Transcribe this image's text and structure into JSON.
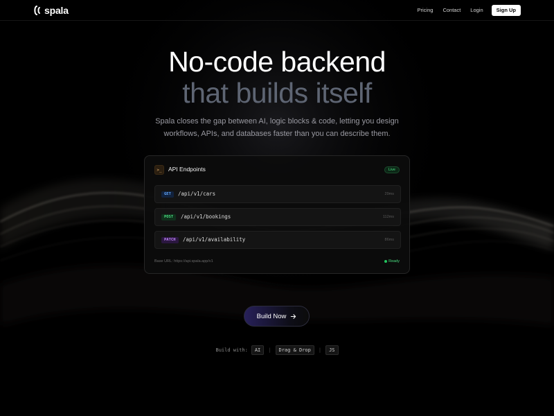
{
  "nav": {
    "brand": "spala",
    "links": [
      "Pricing",
      "Contact",
      "Login"
    ],
    "signup_label": "Sign Up",
    "logo_icon": "spala-logo-icon"
  },
  "hero": {
    "title_line1": "No-code backend",
    "title_line2": "that builds itself",
    "subtitle_line1": "Spala closes the gap between AI, logic blocks & code, letting you design",
    "subtitle_line2": "workflows, APIs, and databases faster than you can describe them."
  },
  "card": {
    "icon_glyph": ">_",
    "title": "API Endpoints",
    "status_badge": "Live",
    "endpoints": [
      {
        "method": "GET",
        "path": "/api/v1/cars",
        "latency": "29ms"
      },
      {
        "method": "POST",
        "path": "/api/v1/bookings",
        "latency": "112ms"
      },
      {
        "method": "PATCH",
        "path": "/api/v1/availability",
        "latency": "86ms"
      }
    ],
    "base_url": "Base URL: https://api.spala.app/v1",
    "ready_label": "Ready"
  },
  "cta": {
    "label": "Build Now",
    "icon": "arrow-right-icon"
  },
  "build_with": {
    "label": "Build with:",
    "options": [
      "AI",
      "Drag & Drop",
      "JS"
    ],
    "separator": "|"
  },
  "colors": {
    "background": "#000000",
    "title_secondary": "#5e6573",
    "live_green": "#4ade80",
    "get_blue": "#60a5fa",
    "patch_purple": "#c084fc",
    "cta_accent": "#27205a"
  }
}
